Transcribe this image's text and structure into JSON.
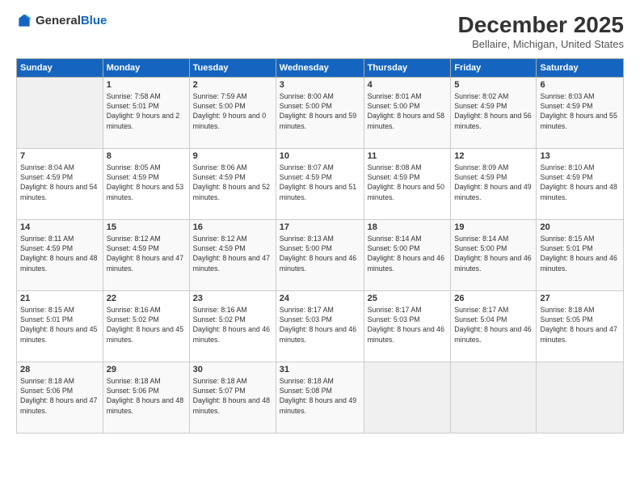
{
  "logo": {
    "general": "General",
    "blue": "Blue"
  },
  "header": {
    "month": "December 2025",
    "location": "Bellaire, Michigan, United States"
  },
  "days_of_week": [
    "Sunday",
    "Monday",
    "Tuesday",
    "Wednesday",
    "Thursday",
    "Friday",
    "Saturday"
  ],
  "weeks": [
    [
      {
        "day": "",
        "sunrise": "",
        "sunset": "",
        "daylight": ""
      },
      {
        "day": "1",
        "sunrise": "Sunrise: 7:58 AM",
        "sunset": "Sunset: 5:01 PM",
        "daylight": "Daylight: 9 hours and 2 minutes."
      },
      {
        "day": "2",
        "sunrise": "Sunrise: 7:59 AM",
        "sunset": "Sunset: 5:00 PM",
        "daylight": "Daylight: 9 hours and 0 minutes."
      },
      {
        "day": "3",
        "sunrise": "Sunrise: 8:00 AM",
        "sunset": "Sunset: 5:00 PM",
        "daylight": "Daylight: 8 hours and 59 minutes."
      },
      {
        "day": "4",
        "sunrise": "Sunrise: 8:01 AM",
        "sunset": "Sunset: 5:00 PM",
        "daylight": "Daylight: 8 hours and 58 minutes."
      },
      {
        "day": "5",
        "sunrise": "Sunrise: 8:02 AM",
        "sunset": "Sunset: 4:59 PM",
        "daylight": "Daylight: 8 hours and 56 minutes."
      },
      {
        "day": "6",
        "sunrise": "Sunrise: 8:03 AM",
        "sunset": "Sunset: 4:59 PM",
        "daylight": "Daylight: 8 hours and 55 minutes."
      }
    ],
    [
      {
        "day": "7",
        "sunrise": "Sunrise: 8:04 AM",
        "sunset": "Sunset: 4:59 PM",
        "daylight": "Daylight: 8 hours and 54 minutes."
      },
      {
        "day": "8",
        "sunrise": "Sunrise: 8:05 AM",
        "sunset": "Sunset: 4:59 PM",
        "daylight": "Daylight: 8 hours and 53 minutes."
      },
      {
        "day": "9",
        "sunrise": "Sunrise: 8:06 AM",
        "sunset": "Sunset: 4:59 PM",
        "daylight": "Daylight: 8 hours and 52 minutes."
      },
      {
        "day": "10",
        "sunrise": "Sunrise: 8:07 AM",
        "sunset": "Sunset: 4:59 PM",
        "daylight": "Daylight: 8 hours and 51 minutes."
      },
      {
        "day": "11",
        "sunrise": "Sunrise: 8:08 AM",
        "sunset": "Sunset: 4:59 PM",
        "daylight": "Daylight: 8 hours and 50 minutes."
      },
      {
        "day": "12",
        "sunrise": "Sunrise: 8:09 AM",
        "sunset": "Sunset: 4:59 PM",
        "daylight": "Daylight: 8 hours and 49 minutes."
      },
      {
        "day": "13",
        "sunrise": "Sunrise: 8:10 AM",
        "sunset": "Sunset: 4:59 PM",
        "daylight": "Daylight: 8 hours and 48 minutes."
      }
    ],
    [
      {
        "day": "14",
        "sunrise": "Sunrise: 8:11 AM",
        "sunset": "Sunset: 4:59 PM",
        "daylight": "Daylight: 8 hours and 48 minutes."
      },
      {
        "day": "15",
        "sunrise": "Sunrise: 8:12 AM",
        "sunset": "Sunset: 4:59 PM",
        "daylight": "Daylight: 8 hours and 47 minutes."
      },
      {
        "day": "16",
        "sunrise": "Sunrise: 8:12 AM",
        "sunset": "Sunset: 4:59 PM",
        "daylight": "Daylight: 8 hours and 47 minutes."
      },
      {
        "day": "17",
        "sunrise": "Sunrise: 8:13 AM",
        "sunset": "Sunset: 5:00 PM",
        "daylight": "Daylight: 8 hours and 46 minutes."
      },
      {
        "day": "18",
        "sunrise": "Sunrise: 8:14 AM",
        "sunset": "Sunset: 5:00 PM",
        "daylight": "Daylight: 8 hours and 46 minutes."
      },
      {
        "day": "19",
        "sunrise": "Sunrise: 8:14 AM",
        "sunset": "Sunset: 5:00 PM",
        "daylight": "Daylight: 8 hours and 46 minutes."
      },
      {
        "day": "20",
        "sunrise": "Sunrise: 8:15 AM",
        "sunset": "Sunset: 5:01 PM",
        "daylight": "Daylight: 8 hours and 46 minutes."
      }
    ],
    [
      {
        "day": "21",
        "sunrise": "Sunrise: 8:15 AM",
        "sunset": "Sunset: 5:01 PM",
        "daylight": "Daylight: 8 hours and 45 minutes."
      },
      {
        "day": "22",
        "sunrise": "Sunrise: 8:16 AM",
        "sunset": "Sunset: 5:02 PM",
        "daylight": "Daylight: 8 hours and 45 minutes."
      },
      {
        "day": "23",
        "sunrise": "Sunrise: 8:16 AM",
        "sunset": "Sunset: 5:02 PM",
        "daylight": "Daylight: 8 hours and 46 minutes."
      },
      {
        "day": "24",
        "sunrise": "Sunrise: 8:17 AM",
        "sunset": "Sunset: 5:03 PM",
        "daylight": "Daylight: 8 hours and 46 minutes."
      },
      {
        "day": "25",
        "sunrise": "Sunrise: 8:17 AM",
        "sunset": "Sunset: 5:03 PM",
        "daylight": "Daylight: 8 hours and 46 minutes."
      },
      {
        "day": "26",
        "sunrise": "Sunrise: 8:17 AM",
        "sunset": "Sunset: 5:04 PM",
        "daylight": "Daylight: 8 hours and 46 minutes."
      },
      {
        "day": "27",
        "sunrise": "Sunrise: 8:18 AM",
        "sunset": "Sunset: 5:05 PM",
        "daylight": "Daylight: 8 hours and 47 minutes."
      }
    ],
    [
      {
        "day": "28",
        "sunrise": "Sunrise: 8:18 AM",
        "sunset": "Sunset: 5:06 PM",
        "daylight": "Daylight: 8 hours and 47 minutes."
      },
      {
        "day": "29",
        "sunrise": "Sunrise: 8:18 AM",
        "sunset": "Sunset: 5:06 PM",
        "daylight": "Daylight: 8 hours and 48 minutes."
      },
      {
        "day": "30",
        "sunrise": "Sunrise: 8:18 AM",
        "sunset": "Sunset: 5:07 PM",
        "daylight": "Daylight: 8 hours and 48 minutes."
      },
      {
        "day": "31",
        "sunrise": "Sunrise: 8:18 AM",
        "sunset": "Sunset: 5:08 PM",
        "daylight": "Daylight: 8 hours and 49 minutes."
      },
      {
        "day": "",
        "sunrise": "",
        "sunset": "",
        "daylight": ""
      },
      {
        "day": "",
        "sunrise": "",
        "sunset": "",
        "daylight": ""
      },
      {
        "day": "",
        "sunrise": "",
        "sunset": "",
        "daylight": ""
      }
    ]
  ]
}
